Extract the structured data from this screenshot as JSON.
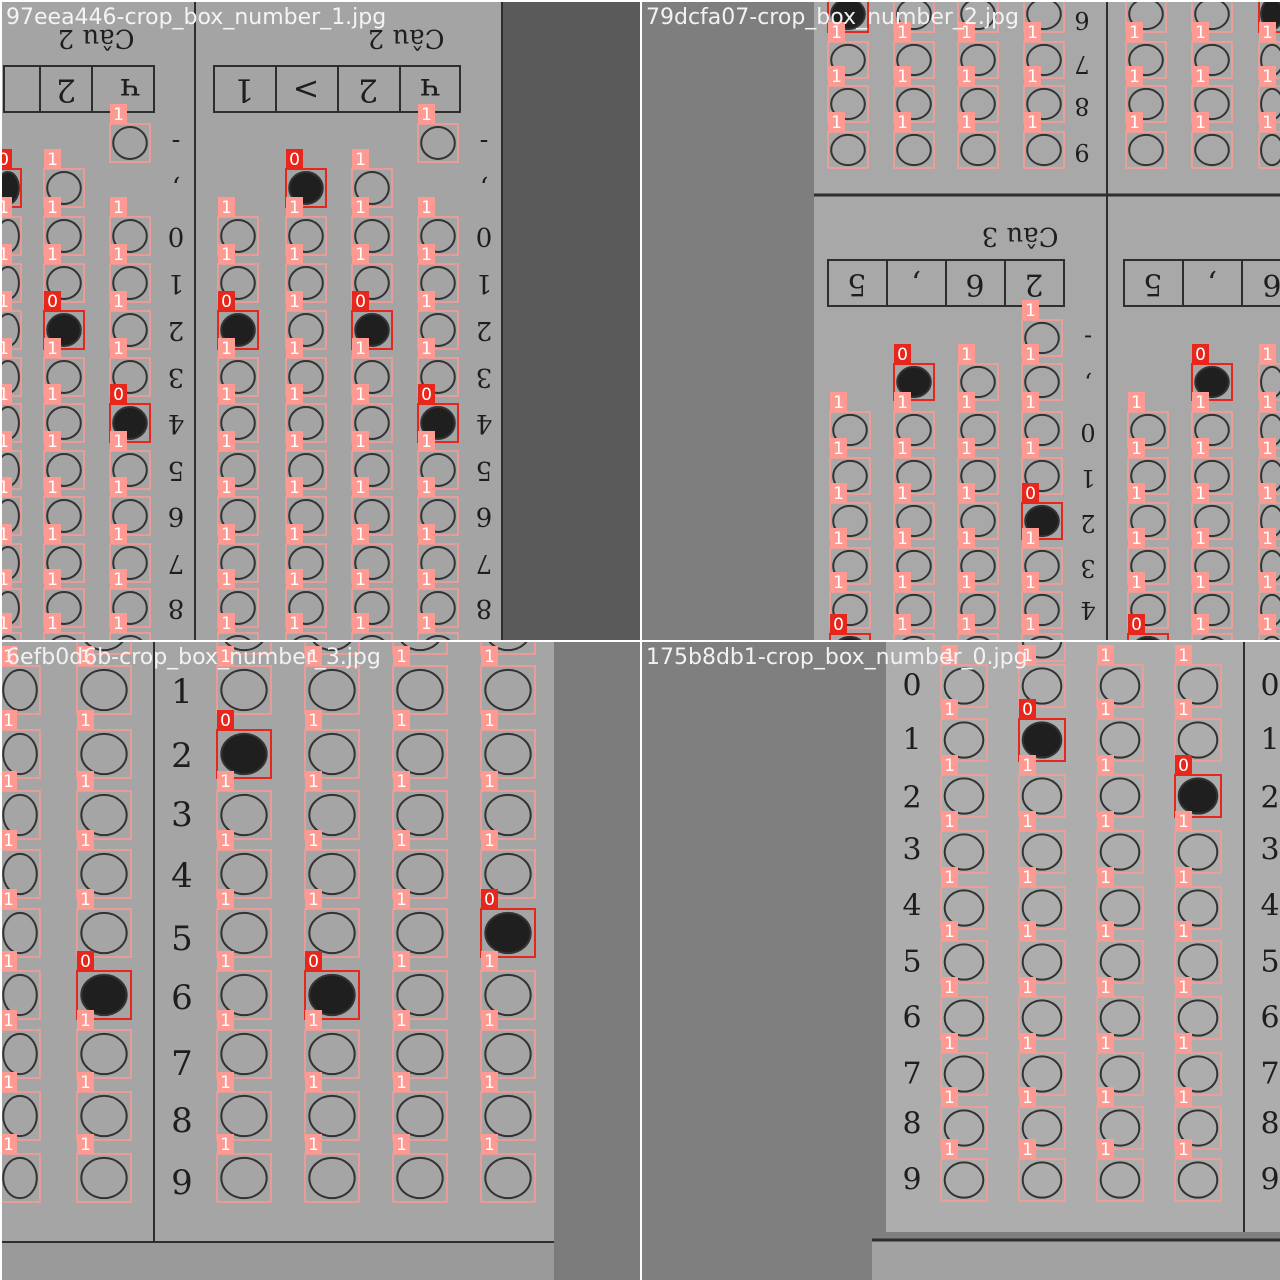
{
  "colors": {
    "mosaic_border": "#ffffff",
    "class0_box": "#e8271c",
    "class1_box": "#ff9a93",
    "label_text": "#ffffff",
    "paper": "#a6a6a6",
    "bubble_outline": "#333333",
    "bubble_filled": "#1f1f1f",
    "background_dark": "#575757",
    "background_mid": "#7f7f7f"
  },
  "class_labels": {
    "filled": "0",
    "empty": "1"
  },
  "tiles": [
    {
      "filename": "97eea446-crop_box_number_1.jpg",
      "question_titles": [
        "Câu 2",
        "Câu 2"
      ],
      "header_digits_left": [
        "ч",
        "2",
        ""
      ],
      "header_digits_right": [
        "ч",
        "2",
        ">",
        "1"
      ],
      "row_labels": [
        "-",
        ",",
        "0",
        "1",
        "2",
        "3",
        "4",
        "5",
        "6",
        "7",
        "8"
      ]
    },
    {
      "filename": "79dcfa07-crop_box_number_2.jpg",
      "question_titles": [
        "Câu 3"
      ],
      "header_digits": [
        "2",
        "6",
        ",",
        "5"
      ],
      "header_digits_right": [
        "6",
        ",",
        "5"
      ],
      "row_labels_top": [
        "6",
        "7",
        "8",
        "9"
      ],
      "row_labels": [
        "-",
        ",",
        "0",
        "1",
        "2",
        "3",
        "4"
      ]
    },
    {
      "filename": "6efb0d6b-crop_box_number_3.jpg",
      "row_labels": [
        "1",
        "2",
        "3",
        "4",
        "5",
        "6",
        "7",
        "8",
        "9"
      ]
    },
    {
      "filename": "175b8db1-crop_box_number_0.jpg",
      "row_labels": [
        "0",
        "1",
        "2",
        "3",
        "4",
        "5",
        "6",
        "7",
        "8",
        "9"
      ]
    }
  ]
}
